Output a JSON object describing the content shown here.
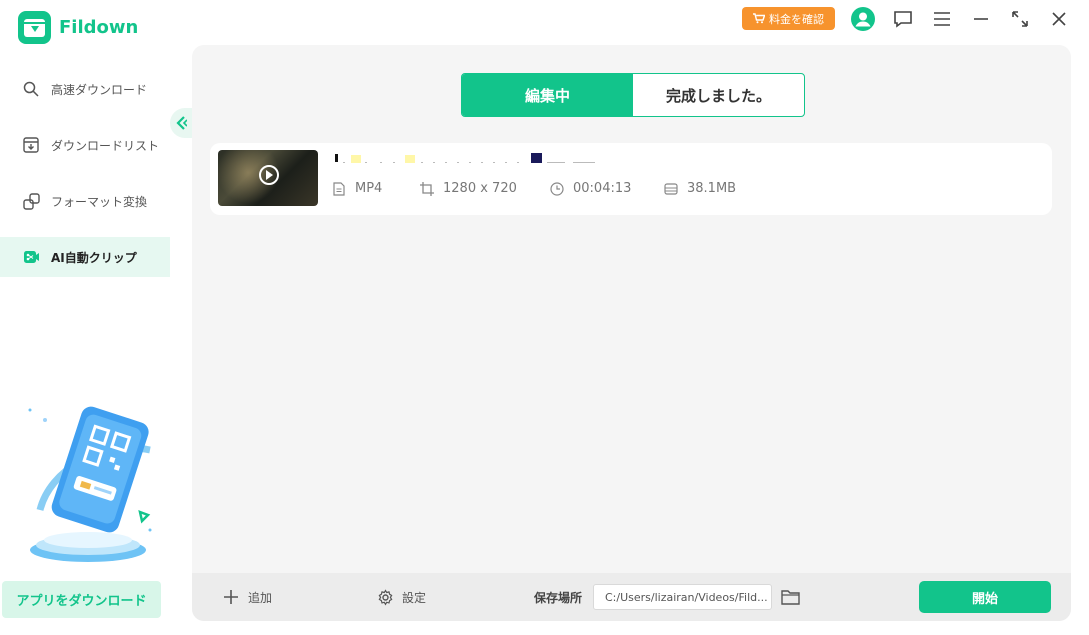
{
  "app": {
    "name": "Fildown"
  },
  "header": {
    "pricing_label": "料金を確認",
    "icons": [
      "user-icon",
      "feedback-icon",
      "menu-icon",
      "minimize-icon",
      "fullscreen-icon",
      "close-icon"
    ]
  },
  "sidebar": {
    "items": [
      {
        "label": "高速ダウンロード",
        "icon": "search-icon",
        "active": false
      },
      {
        "label": "ダウンロードリスト",
        "icon": "download-list-icon",
        "active": false
      },
      {
        "label": "フォーマット変換",
        "icon": "convert-icon",
        "active": false
      },
      {
        "label": "AI自動クリップ",
        "icon": "ai-clip-icon",
        "active": true
      }
    ],
    "app_download_label": "アプリをダウンロード"
  },
  "tabs": {
    "editing": "編集中",
    "completed": "完成しました。"
  },
  "video": {
    "format": "MP4",
    "resolution": "1280 x 720",
    "duration": "00:04:13",
    "size": "38.1MB"
  },
  "bottom_bar": {
    "add_label": "追加",
    "settings_label": "設定",
    "save_location_label": "保存場所",
    "save_path": "C:/Users/lizairan/Videos/Fild...",
    "start_label": "開始"
  },
  "colors": {
    "accent": "#12c48b",
    "pricing": "#f7932d",
    "main_bg": "#f5f5f5"
  }
}
